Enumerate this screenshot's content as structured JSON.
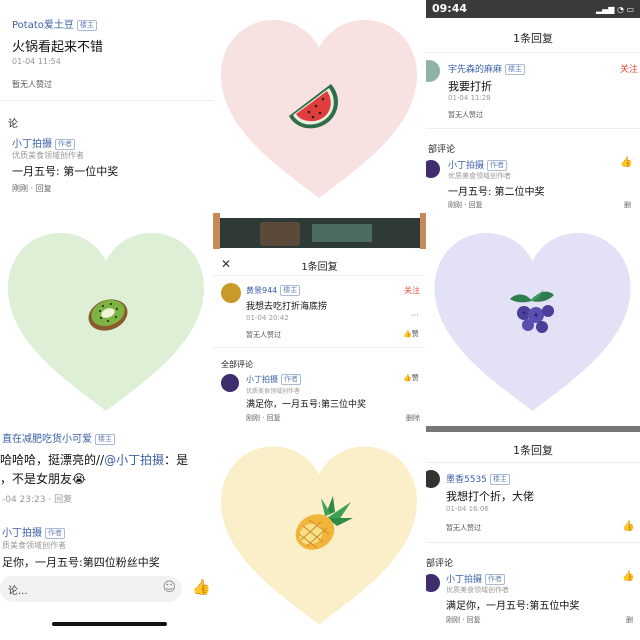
{
  "tile00": {
    "username": "Potato爱土豆",
    "badge": "楼主",
    "comment": "火锅看起来不错",
    "time": "01-04 11:54",
    "likes": "暂无人赞过",
    "section": "论",
    "reply_user": "小丁拍摄",
    "reply_badge": "作者",
    "reply_desc": "优质美食领域创作者",
    "reply_text": "一月五号: 第一位中奖",
    "reply_meta": "刚刚 · 回复"
  },
  "tile01": {
    "fruit": "watermelon",
    "bg": "#f7e1e1"
  },
  "tile02": {
    "status_time": "09:44",
    "title": "1条回复",
    "username": "宇先森的麻麻",
    "badge": "楼主",
    "follow": "关注",
    "comment": "我要打折",
    "time": "01-04 11:28",
    "likes": "暂无人赞过",
    "section": "部评论",
    "reply_user": "小丁拍摄",
    "reply_badge": "作者",
    "reply_desc": "优质美食领域创作者",
    "reply_text": "一月五号: 第二位中奖",
    "reply_meta": "刚刚 · 回复",
    "reply_delete": "删"
  },
  "tile10": {
    "fruit": "kiwi",
    "bg": "#ddefd4"
  },
  "tile11": {
    "title": "1条回复",
    "username": "黄景944",
    "badge": "楼主",
    "follow": "关注",
    "comment": "我想去吃打折海底捞",
    "time": "01-04 20:42",
    "more": "···",
    "likes": "暂无人赞过",
    "like_label": "赞",
    "section": "全部评论",
    "reply_user": "小丁拍摄",
    "reply_badge": "作者",
    "reply_desc": "优质美食领域创作者",
    "reply_text": "满足你，一月五号:第三位中奖",
    "reply_meta": "刚刚 · 回复",
    "reply_delete": "删除",
    "reply_like_label": "赞"
  },
  "tile12": {
    "fruit": "blueberry",
    "bg": "#e2e1f5"
  },
  "tile20": {
    "username": "直在减肥吃货小可爱",
    "badge": "楼主",
    "comment_line1_plain": "哈哈哈，挺漂亮的//",
    "comment_line1_link": "@小丁拍摄",
    "comment_line1_tail": "：是",
    "comment_line2": "，不是女朋友😭",
    "time": "-04 23:23 · 回复",
    "reply_user": "小丁拍摄",
    "reply_badge": "作者",
    "reply_desc": "质美食领域创作者",
    "reply_text": "足你，一月五号:第四位粉丝中奖",
    "input_placeholder": "论..."
  },
  "tile21": {
    "fruit": "pineapple",
    "bg": "#faefc9"
  },
  "tile22": {
    "title": "1条回复",
    "username": "墨香5535",
    "badge": "楼主",
    "comment": "我想打个折，大佬",
    "time": "01-04 16:06",
    "likes": "暂无人赞过",
    "section": "部评论",
    "reply_user": "小丁拍摄",
    "reply_badge": "作者",
    "reply_desc": "优质美食领域创作者",
    "reply_text": "满足你，一月五号:第五位中奖",
    "reply_meta": "刚刚 · 回复",
    "reply_delete": "删"
  }
}
